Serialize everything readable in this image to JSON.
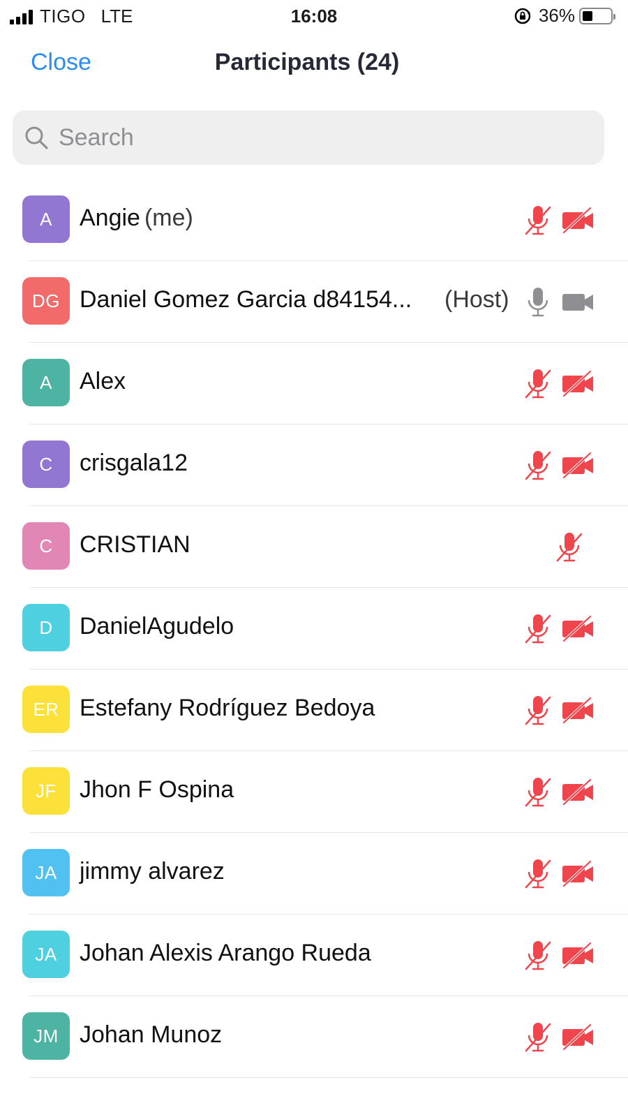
{
  "status_bar": {
    "carrier": "TIGO",
    "network": "LTE",
    "time": "16:08",
    "battery": "36%",
    "battery_level": 0.36
  },
  "header": {
    "close_label": "Close",
    "title": "Participants (24)"
  },
  "search": {
    "placeholder": "Search"
  },
  "colors": {
    "accent": "#2d8cf0",
    "muted_red": "#f0454c",
    "active_gray": "#8e8e93"
  },
  "participants": [
    {
      "initials": "A",
      "name": "Angie",
      "suffix": "(me)",
      "avatar_color": "#9176d2",
      "mic": "muted",
      "video": "off"
    },
    {
      "initials": "DG",
      "name": "Daniel Gomez Garcia d84154...",
      "host_tag": "(Host)",
      "avatar_color": "#f26a6a",
      "mic": "on",
      "video": "on"
    },
    {
      "initials": "A",
      "name": "Alex",
      "avatar_color": "#4db3a2",
      "mic": "muted",
      "video": "off"
    },
    {
      "initials": "C",
      "name": "crisgala12",
      "avatar_color": "#9176d2",
      "mic": "muted",
      "video": "off"
    },
    {
      "initials": "C",
      "name": "CRISTIAN",
      "avatar_color": "#e287b5",
      "mic": "muted",
      "video": "none"
    },
    {
      "initials": "D",
      "name": "DanielAgudelo",
      "avatar_color": "#4fd0e0",
      "mic": "muted",
      "video": "off"
    },
    {
      "initials": "ER",
      "name": "Estefany Rodríguez Bedoya",
      "avatar_color": "#fce13a",
      "mic": "muted",
      "video": "off"
    },
    {
      "initials": "JF",
      "name": "Jhon F Ospina",
      "avatar_color": "#fce13a",
      "mic": "muted",
      "video": "off"
    },
    {
      "initials": "JA",
      "name": "jimmy alvarez",
      "avatar_color": "#51c1f2",
      "mic": "muted",
      "video": "off"
    },
    {
      "initials": "JA",
      "name": "Johan Alexis Arango Rueda",
      "avatar_color": "#4fd0e0",
      "mic": "muted",
      "video": "off"
    },
    {
      "initials": "JM",
      "name": "Johan Munoz",
      "avatar_color": "#4db3a2",
      "mic": "muted",
      "video": "off"
    }
  ]
}
